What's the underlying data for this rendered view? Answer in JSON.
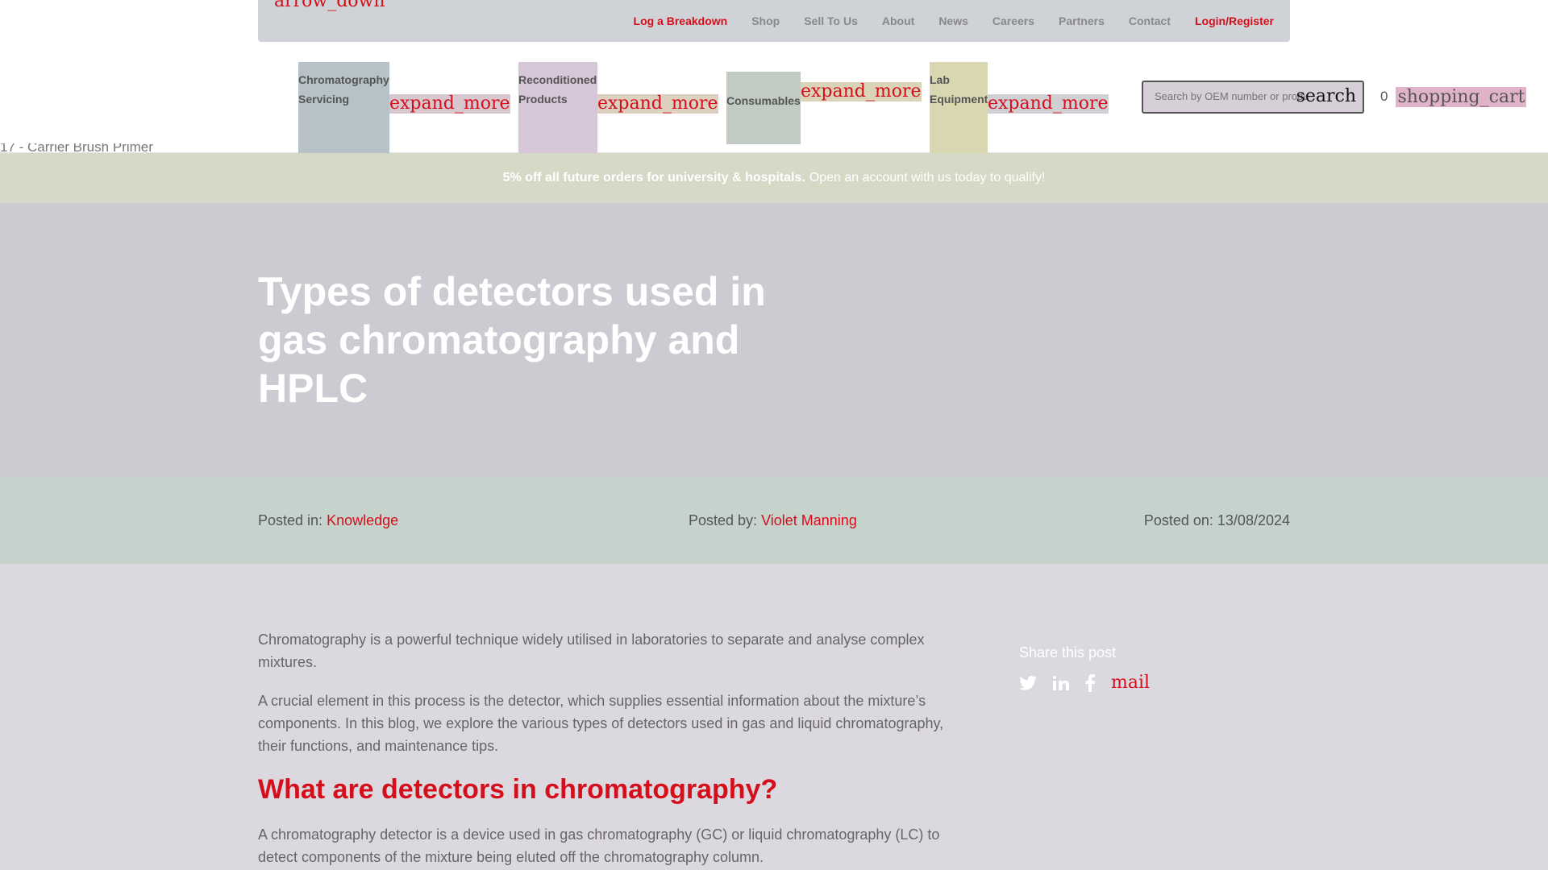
{
  "topbar": {
    "broken_icon": "arrow_down",
    "links": [
      "Log a Breakdown",
      "Shop",
      "Sell To Us",
      "About",
      "News",
      "Careers",
      "Partners",
      "Contact",
      "Login/Register"
    ]
  },
  "mainnav": {
    "items": [
      {
        "label": "Chromatography Servicing",
        "bg": "#b6c2c8"
      },
      {
        "label": "Reconditioned Products",
        "bg": "#d6c6d8"
      },
      {
        "label": "Consumables",
        "bg": "#c2cbc3"
      },
      {
        "label": "Lab Equipment",
        "bg": "#d9d7b2"
      }
    ],
    "expand_icon": "expand_more",
    "search_placeholder": "Search by OEM number or product",
    "search_icon": "search",
    "cart_count": "0",
    "cart_icon": "shopping_cart"
  },
  "broken_image_alt": "17 - Carrier Brush Primer",
  "promo": {
    "bold": "5% off all future orders for university & hospitals.",
    "text": "Open an account with us today to qualify!"
  },
  "hero": {
    "title": "Types of detectors used in gas chromatography and HPLC"
  },
  "meta": {
    "posted_in_label": "Posted in:",
    "posted_in": "Knowledge",
    "posted_by_label": "Posted by:",
    "posted_by": "Violet Manning",
    "posted_on_label": "Posted on:",
    "posted_on": "13/08/2024"
  },
  "article": {
    "p1": "Chromatography is a powerful technique widely utilised in laboratories to separate and analyse complex mixtures.",
    "p2": "A crucial element in this process is the detector, which supplies essential information about the mixture’s components. In this blog, we explore the various types of detectors used in gas and liquid chromatography, their functions, and maintenance tips.",
    "h2": "What are detectors in chromatography?",
    "p3": "A chromatography detector is a device used in gas chromatography (GC) or liquid chromatography (LC) to detect components of the mixture being eluted off the chromatography column."
  },
  "share": {
    "title": "Share this post",
    "mail_icon": "mail"
  },
  "colors": {
    "accent": "#d40f1b"
  }
}
